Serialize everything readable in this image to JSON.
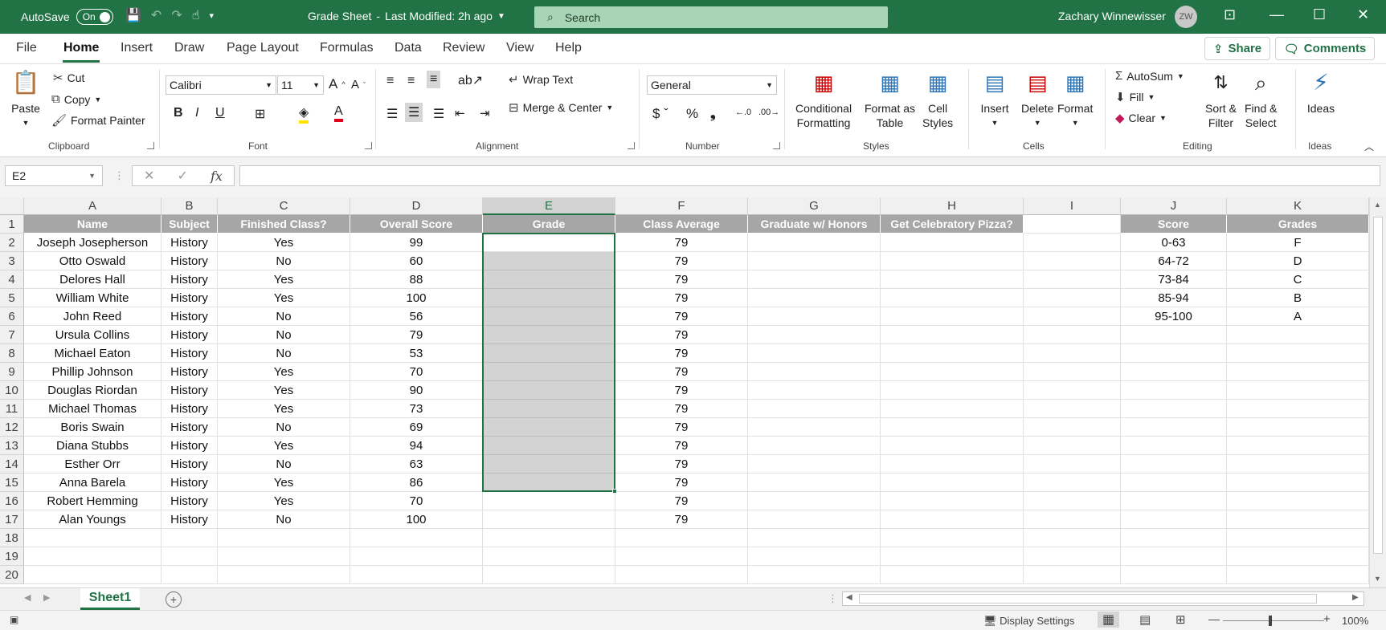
{
  "titlebar": {
    "autosave_label": "AutoSave",
    "autosave_state": "On",
    "doc_title": "Grade Sheet",
    "separator": "-",
    "last_modified": "Last Modified: 2h ago",
    "search_placeholder": "Search",
    "user_name": "Zachary Winnewisser",
    "user_initials": "ZW"
  },
  "menu": {
    "tabs": [
      "File",
      "Home",
      "Insert",
      "Draw",
      "Page Layout",
      "Formulas",
      "Data",
      "Review",
      "View",
      "Help"
    ],
    "active": "Home",
    "share": "Share",
    "comments": "Comments"
  },
  "ribbon": {
    "clipboard": {
      "label": "Clipboard",
      "paste": "Paste",
      "cut": "Cut",
      "copy": "Copy",
      "format_painter": "Format Painter"
    },
    "font": {
      "label": "Font",
      "family": "Calibri",
      "size": "11"
    },
    "alignment": {
      "label": "Alignment",
      "wrap": "Wrap Text",
      "merge": "Merge & Center"
    },
    "number": {
      "label": "Number",
      "format": "General"
    },
    "styles": {
      "label": "Styles",
      "conditional": [
        "Conditional",
        "Formatting"
      ],
      "format_table": [
        "Format as",
        "Table"
      ],
      "cell_styles": [
        "Cell",
        "Styles"
      ]
    },
    "cells": {
      "label": "Cells",
      "insert": "Insert",
      "delete": "Delete",
      "format": "Format"
    },
    "editing": {
      "label": "Editing",
      "autosum": "AutoSum",
      "fill": "Fill",
      "clear": "Clear",
      "sort": [
        "Sort &",
        "Filter"
      ],
      "find": [
        "Find &",
        "Select"
      ]
    },
    "ideas": {
      "label": "Ideas",
      "button": "Ideas"
    }
  },
  "formula_bar": {
    "name_box": "E2",
    "value": ""
  },
  "columns": [
    "A",
    "B",
    "C",
    "D",
    "E",
    "F",
    "G",
    "H",
    "I",
    "J",
    "K"
  ],
  "selected_column": "E",
  "rows": [
    "1",
    "2",
    "3",
    "4",
    "5",
    "6",
    "7",
    "8",
    "9",
    "10",
    "11",
    "12",
    "13",
    "14",
    "15",
    "16",
    "17",
    "18",
    "19",
    "20"
  ],
  "table_headers": [
    "Name",
    "Subject",
    "Finished Class?",
    "Overall Score",
    "Grade",
    "Class Average",
    "Graduate w/ Honors",
    "Get Celebratory Pizza?"
  ],
  "table_rows": [
    [
      "Joseph Josepherson",
      "History",
      "Yes",
      "99",
      "",
      "79"
    ],
    [
      "Otto Oswald",
      "History",
      "No",
      "60",
      "",
      "79"
    ],
    [
      "Delores Hall",
      "History",
      "Yes",
      "88",
      "",
      "79"
    ],
    [
      "William White",
      "History",
      "Yes",
      "100",
      "",
      "79"
    ],
    [
      "John Reed",
      "History",
      "No",
      "56",
      "",
      "79"
    ],
    [
      "Ursula Collins",
      "History",
      "No",
      "79",
      "",
      "79"
    ],
    [
      "Michael Eaton",
      "History",
      "No",
      "53",
      "",
      "79"
    ],
    [
      "Phillip Johnson",
      "History",
      "Yes",
      "70",
      "",
      "79"
    ],
    [
      "Douglas Riordan",
      "History",
      "Yes",
      "90",
      "",
      "79"
    ],
    [
      "Michael Thomas",
      "History",
      "Yes",
      "73",
      "",
      "79"
    ],
    [
      "Boris Swain",
      "History",
      "No",
      "69",
      "",
      "79"
    ],
    [
      "Diana Stubbs",
      "History",
      "Yes",
      "94",
      "",
      "79"
    ],
    [
      "Esther Orr",
      "History",
      "No",
      "63",
      "",
      "79"
    ],
    [
      "Anna Barela",
      "History",
      "Yes",
      "86",
      "",
      "79"
    ],
    [
      "Robert Hemming",
      "History",
      "Yes",
      "70",
      "",
      "79"
    ],
    [
      "Alan Youngs",
      "History",
      "No",
      "100",
      "",
      "79"
    ]
  ],
  "grade_scale": {
    "headers": [
      "Score",
      "Grades"
    ],
    "rows": [
      [
        "0-63",
        "F"
      ],
      [
        "64-72",
        "D"
      ],
      [
        "73-84",
        "C"
      ],
      [
        "85-94",
        "B"
      ],
      [
        "95-100",
        "A"
      ]
    ]
  },
  "sheet_tabs": [
    "Sheet1"
  ],
  "status": {
    "display_settings": "Display Settings",
    "zoom": "100%"
  },
  "colors": {
    "accent": "#217346",
    "header_fill": "#a6a6a6",
    "selection_fill": "#d3d3d3"
  }
}
